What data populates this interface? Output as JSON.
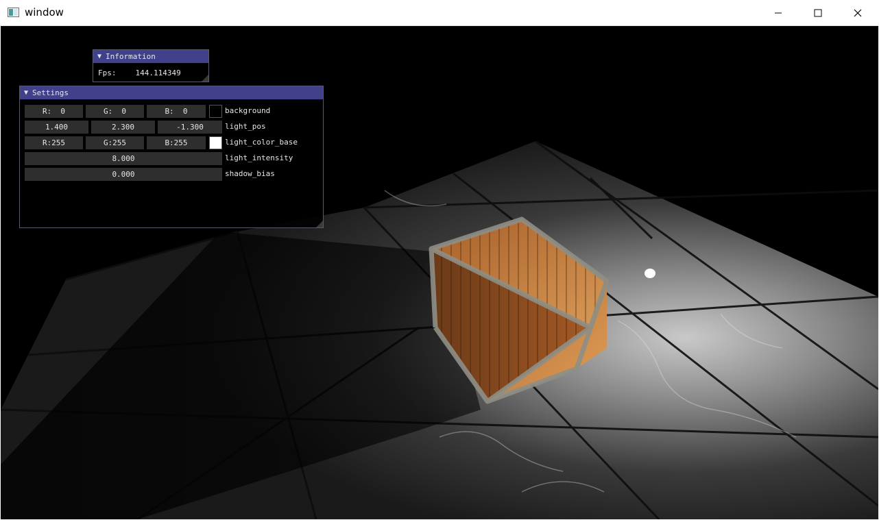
{
  "window": {
    "title": "window",
    "controls": {
      "minimize": "minimize-icon",
      "maximize": "maximize-icon",
      "close": "close-icon"
    }
  },
  "info_panel": {
    "title": "Information",
    "fps_label": "Fps:",
    "fps_value": "144.114349"
  },
  "settings_panel": {
    "title": "Settings",
    "background": {
      "r": "R:  0",
      "g": "G:  0",
      "b": "B:  0",
      "color": "#000000",
      "label": "background"
    },
    "light_pos": {
      "x": "1.400",
      "y": "2.300",
      "z": "-1.300",
      "label": "light_pos"
    },
    "light_color_base": {
      "r": "R:255",
      "g": "G:255",
      "b": "B:255",
      "color": "#ffffff",
      "label": "light_color_base"
    },
    "light_intensity": {
      "value": "8.000",
      "label": "light_intensity"
    },
    "shadow_bias": {
      "value": "0.000",
      "label": "shadow_bias"
    }
  },
  "colors": {
    "imgui_title": "#41408a",
    "field_bg": "#2e2e2e",
    "crate": "#b4662c",
    "floor": "#6e6e6e"
  }
}
